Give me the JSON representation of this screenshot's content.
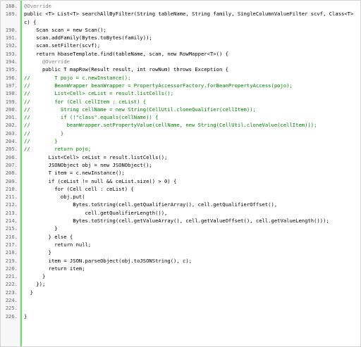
{
  "lines": [
    {
      "n": "188.",
      "t": "@Override",
      "cls": "c-annot"
    },
    {
      "n": "189.",
      "t": "  public <T> List<T> searchAllByFilter(String tableName, String family, SingleColumnValueFilter scvf, Class<T> c) {",
      "cls": "c-plain",
      "wrap": true
    },
    {
      "n": "190.",
      "t": "    Scan scan = new Scan();",
      "cls": "c-plain"
    },
    {
      "n": "191.",
      "t": "    scan.addFamily(Bytes.toBytes(family));",
      "cls": "c-plain"
    },
    {
      "n": "192.",
      "t": "    scan.setFilter(scvf);",
      "cls": "c-plain"
    },
    {
      "n": "193.",
      "t": "    return hbaseTemplate.find(tableName, scan, new RowMapper<T>() {",
      "cls": "c-plain"
    },
    {
      "n": "194.",
      "t": "      @Override",
      "cls": "c-annot"
    },
    {
      "n": "195.",
      "t": "      public T mapRow(Result result, int rowNum) throws Exception {",
      "cls": "c-plain"
    },
    {
      "n": "196.",
      "t": "//        T pojo = c.newInstance();",
      "cls": "c-comment"
    },
    {
      "n": "197.",
      "t": "//        BeanWrapper beanWrapper = PropertyAccessorFactory.forBeanPropertyAccess(pojo);",
      "cls": "c-comment"
    },
    {
      "n": "198.",
      "t": "//        List<Cell> ceList = result.listCells();",
      "cls": "c-comment"
    },
    {
      "n": "199.",
      "t": "//        for (Cell cellItem : ceList) {",
      "cls": "c-comment"
    },
    {
      "n": "200.",
      "t": "//          String cellName = new String(CellUtil.cloneQualifier(cellItem));",
      "cls": "c-comment"
    },
    {
      "n": "201.",
      "t": "//          if (!\"class\".equals(cellName)) {",
      "cls": "c-comment"
    },
    {
      "n": "202.",
      "t": "//            beanWrapper.setPropertyValue(cellName, new String(CellUtil.cloneValue(cellItem)));",
      "cls": "c-comment"
    },
    {
      "n": "203.",
      "t": "//          }",
      "cls": "c-comment"
    },
    {
      "n": "204.",
      "t": "//        }",
      "cls": "c-comment"
    },
    {
      "n": "205.",
      "t": "//        return pojo;",
      "cls": "c-comment"
    },
    {
      "n": "206.",
      "t": "        List<Cell> ceList = result.listCells();",
      "cls": "c-plain"
    },
    {
      "n": "207.",
      "t": "        JSONObject obj = new JSONObject();",
      "cls": "c-plain"
    },
    {
      "n": "208.",
      "t": "        T item = c.newInstance();",
      "cls": "c-plain"
    },
    {
      "n": "209.",
      "t": "        if (ceList != null && ceList.size() > 0) {",
      "cls": "c-plain"
    },
    {
      "n": "210.",
      "t": "          for (Cell cell : ceList) {",
      "cls": "c-plain"
    },
    {
      "n": "211.",
      "t": "            obj.put(",
      "cls": "c-plain"
    },
    {
      "n": "212.",
      "t": "                Bytes.toString(cell.getQualifierArray(), cell.getQualifierOffset(),",
      "cls": "c-plain"
    },
    {
      "n": "213.",
      "t": "                    cell.getQualifierLength()),",
      "cls": "c-plain"
    },
    {
      "n": "214.",
      "t": "                Bytes.toString(cell.getValueArray(), cell.getValueOffset(), cell.getValueLength()));",
      "cls": "c-plain"
    },
    {
      "n": "215.",
      "t": "          }",
      "cls": "c-plain"
    },
    {
      "n": "216.",
      "t": "        } else {",
      "cls": "c-plain"
    },
    {
      "n": "217.",
      "t": "          return null;",
      "cls": "c-plain"
    },
    {
      "n": "218.",
      "t": "        }",
      "cls": "c-plain"
    },
    {
      "n": "219.",
      "t": "        item = JSON.parseObject(obj.toJSONString(), c);",
      "cls": "c-plain"
    },
    {
      "n": "220.",
      "t": "        return item;",
      "cls": "c-plain"
    },
    {
      "n": "221.",
      "t": "      }",
      "cls": "c-plain"
    },
    {
      "n": "222.",
      "t": "    });",
      "cls": "c-plain"
    },
    {
      "n": "223.",
      "t": "  }",
      "cls": "c-plain"
    },
    {
      "n": "224.",
      "t": "",
      "cls": "c-plain"
    },
    {
      "n": "225.",
      "t": "",
      "cls": "c-plain"
    },
    {
      "n": "226.",
      "t": "}",
      "cls": "c-plain"
    }
  ]
}
